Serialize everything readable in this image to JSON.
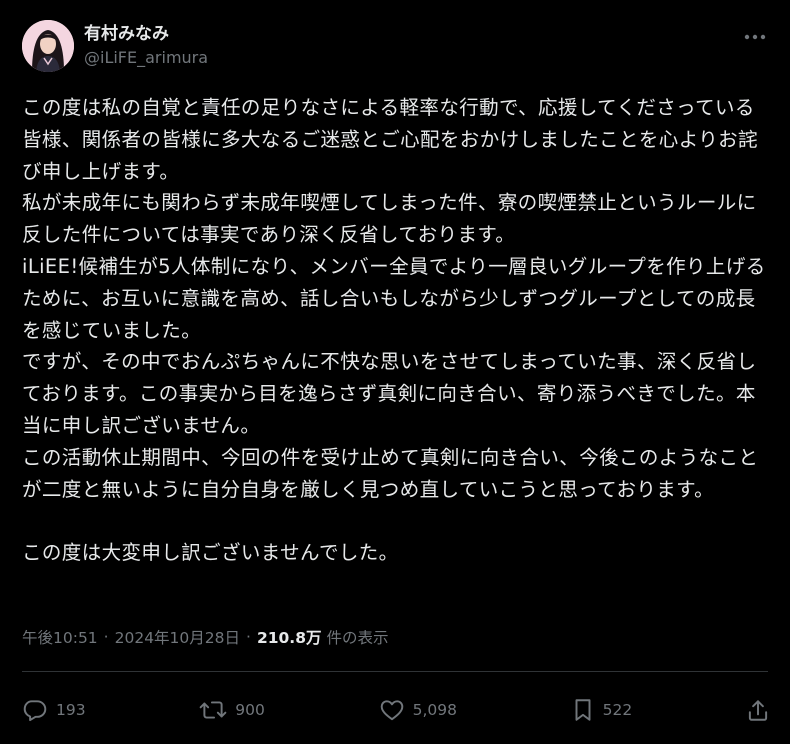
{
  "author": {
    "display_name": "有村みなみ",
    "handle": "@iLiFE_arimura"
  },
  "post": {
    "text": "この度は私の自覚と責任の足りなさによる軽率な行動で、応援してくださっている皆様、関係者の皆様に多大なるご迷惑とご心配をおかけしましたことを心よりお詫び申し上げます。\n私が未成年にも関わらず未成年喫煙してしまった件、寮の喫煙禁止というルールに反した件については事実であり深く反省しております。\niLiEE!候補生が5人体制になり、メンバー全員でより一層良いグループを作り上げるために、お互いに意識を高め、話し合いもしながら少しずつグループとしての成長を感じていました。\nですが、その中でおんぷちゃんに不快な思いをさせてしまっていた事、深く反省しております。この事実から目を逸らさず真剣に向き合い、寄り添うべきでした。本当に申し訳ございません。\nこの活動休止期間中、今回の件を受け止めて真剣に向き合い、今後このようなことが二度と無いように自分自身を厳しく見つめ直していこうと思っております。\n\nこの度は大変申し訳ございませんでした。",
    "time": "午後10:51",
    "separator": "·",
    "date": "2024年10月28日",
    "views_count": "210.8万",
    "views_label": "件の表示"
  },
  "actions": {
    "replies": "193",
    "reposts": "900",
    "likes": "5,098",
    "bookmarks": "522"
  },
  "icons": {
    "more": "more-icon",
    "reply": "reply-icon",
    "repost": "repost-icon",
    "like": "like-icon",
    "bookmark": "bookmark-icon",
    "share": "share-icon"
  },
  "colors": {
    "background": "#000000",
    "text": "#e7e9ea",
    "secondary": "#71767b",
    "divider": "#2f3336"
  }
}
